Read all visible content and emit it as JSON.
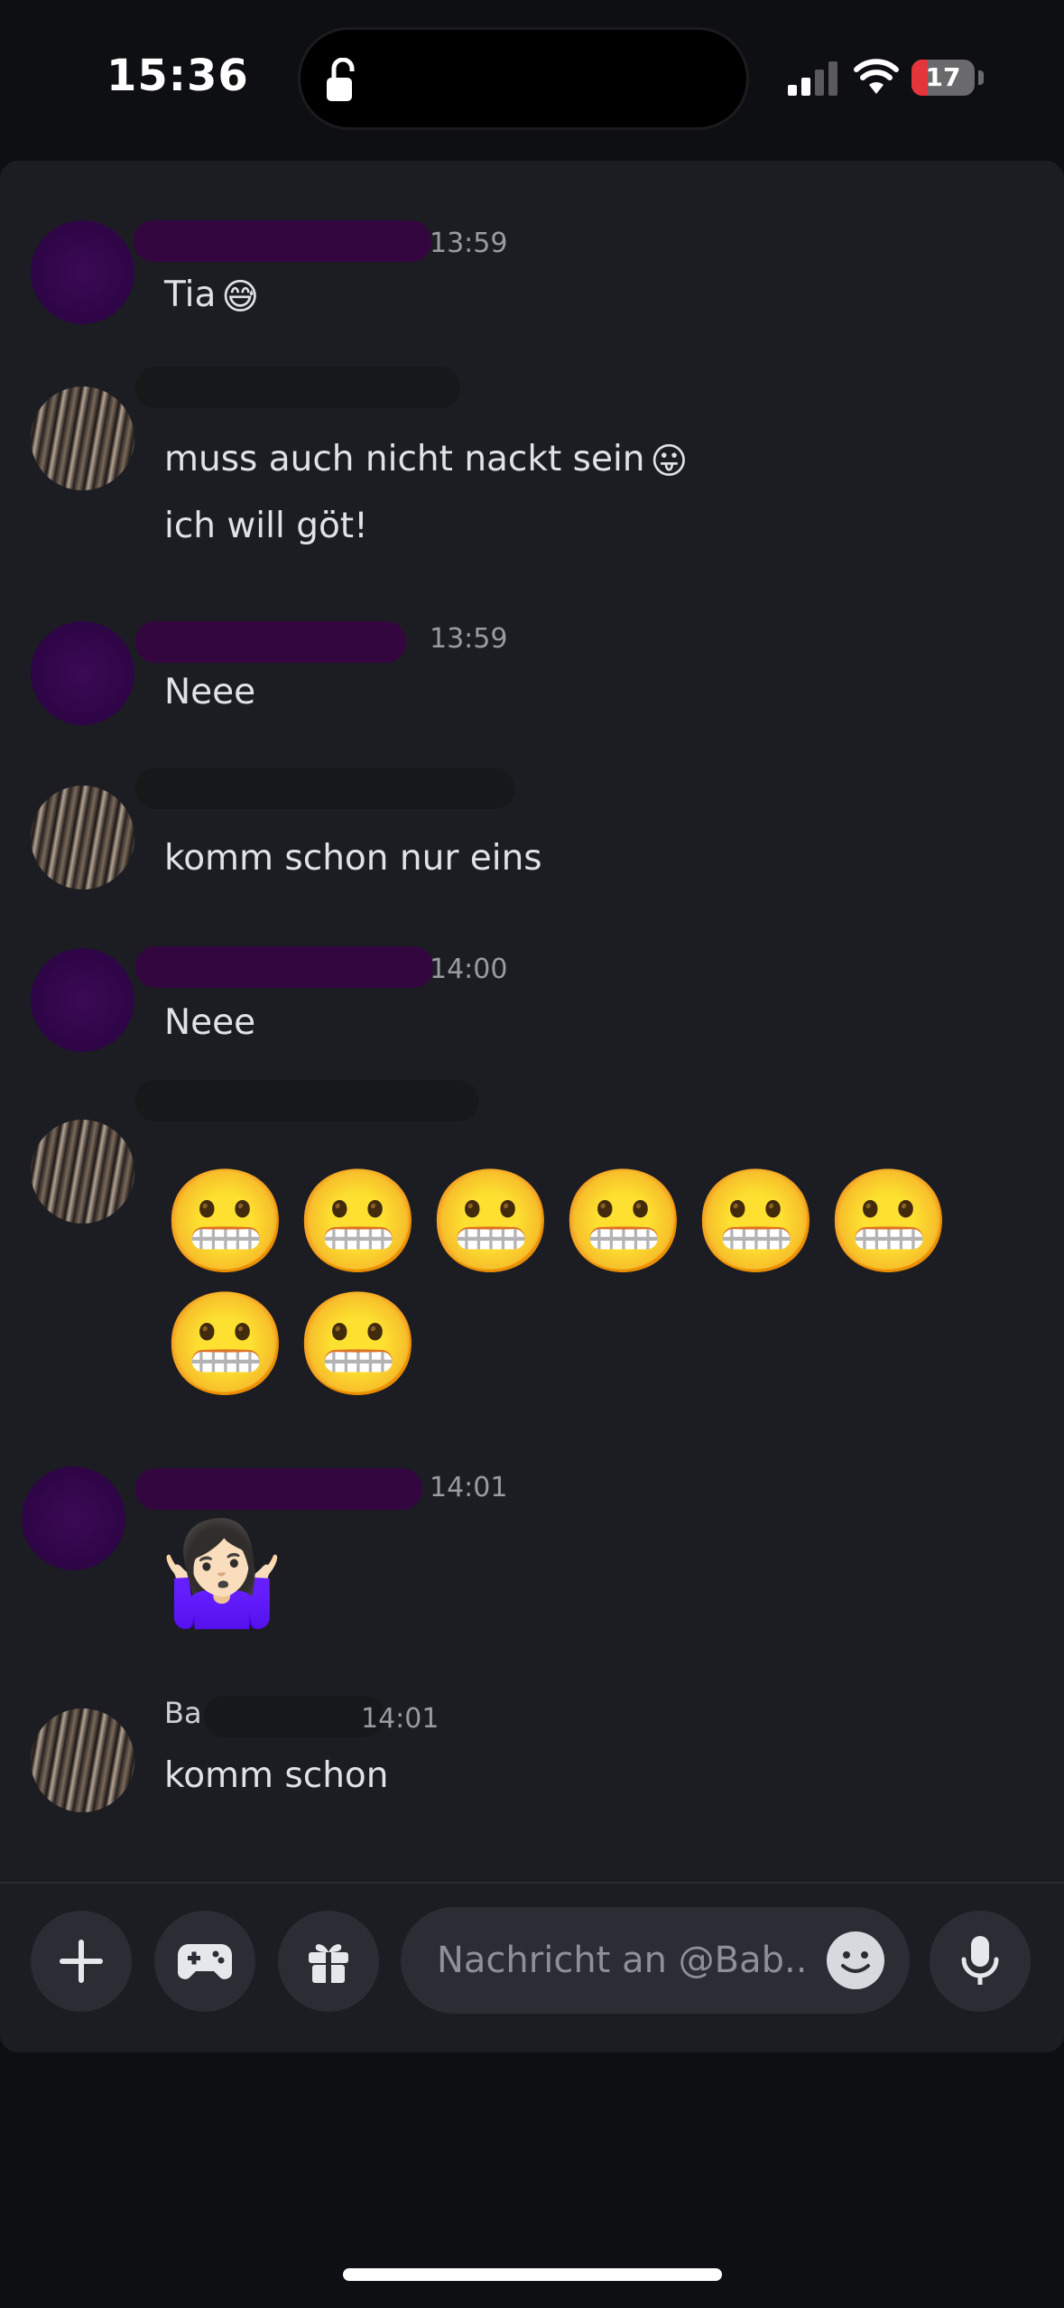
{
  "status_bar": {
    "time": "15:36",
    "battery_level": "17",
    "battery_color": "#e5343a"
  },
  "messages": [
    {
      "timestamp": "13:59",
      "lines": [
        "Tia"
      ],
      "emoji": "😅"
    },
    {
      "timestamp": "",
      "lines": [
        "muss auch nicht nackt sein",
        "ich will göt!"
      ],
      "emoji": "😛"
    },
    {
      "timestamp": "13:59",
      "lines": [
        "Neee"
      ]
    },
    {
      "timestamp": "",
      "lines": [
        "komm schon nur eins"
      ]
    },
    {
      "timestamp": "14:00",
      "lines": [
        "Neee"
      ]
    },
    {
      "timestamp": "",
      "emojis": [
        "😬",
        "😬",
        "😬",
        "😬",
        "😬",
        "😬",
        "😬",
        "😬"
      ]
    },
    {
      "timestamp": "14:01",
      "emojis": [
        "🤷🏻‍♀️"
      ]
    },
    {
      "timestamp": "14:01",
      "name_fragment": "Ba",
      "lines": [
        "komm schon"
      ]
    }
  ],
  "composer": {
    "placeholder": "Nachricht an @Bab...",
    "icons": [
      "plus-icon",
      "gamepad-icon",
      "gift-icon",
      "smiley-icon",
      "microphone-icon"
    ]
  },
  "colors": {
    "panel_bg": "#1c1d22",
    "redact_purple": "#34063f",
    "accent_battery": "#e5343a"
  }
}
